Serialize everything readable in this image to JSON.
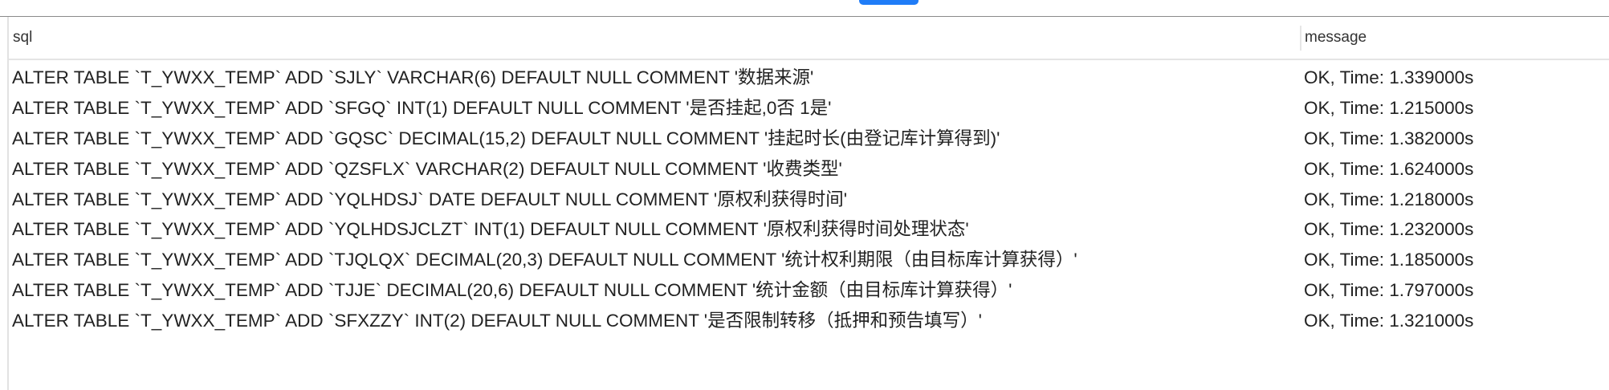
{
  "table": {
    "columns": [
      "sql",
      "message"
    ],
    "rows": [
      {
        "sql": "ALTER TABLE `T_YWXX_TEMP` ADD `SJLY` VARCHAR(6) DEFAULT NULL COMMENT '数据来源'",
        "message": "OK, Time: 1.339000s"
      },
      {
        "sql": "ALTER TABLE `T_YWXX_TEMP` ADD `SFGQ` INT(1) DEFAULT NULL COMMENT '是否挂起,0否 1是'",
        "message": "OK, Time: 1.215000s"
      },
      {
        "sql": "ALTER TABLE `T_YWXX_TEMP` ADD `GQSC` DECIMAL(15,2) DEFAULT NULL COMMENT '挂起时长(由登记库计算得到)'",
        "message": "OK, Time: 1.382000s"
      },
      {
        "sql": "ALTER TABLE `T_YWXX_TEMP` ADD `QZSFLX` VARCHAR(2) DEFAULT NULL COMMENT '收费类型'",
        "message": "OK, Time: 1.624000s"
      },
      {
        "sql": "ALTER TABLE `T_YWXX_TEMP` ADD `YQLHDSJ` DATE DEFAULT NULL COMMENT '原权利获得时间'",
        "message": "OK, Time: 1.218000s"
      },
      {
        "sql": "ALTER TABLE `T_YWXX_TEMP` ADD `YQLHDSJCLZT` INT(1) DEFAULT NULL COMMENT '原权利获得时间处理状态'",
        "message": "OK, Time: 1.232000s"
      },
      {
        "sql": "ALTER TABLE `T_YWXX_TEMP` ADD `TJQLQX` DECIMAL(20,3) DEFAULT NULL COMMENT '统计权利期限（由目标库计算获得）'",
        "message": "OK, Time: 1.185000s"
      },
      {
        "sql": "ALTER TABLE `T_YWXX_TEMP` ADD `TJJE` DECIMAL(20,6) DEFAULT NULL COMMENT '统计金额（由目标库计算获得）'",
        "message": "OK, Time: 1.797000s"
      },
      {
        "sql": "ALTER TABLE `T_YWXX_TEMP` ADD `SFXZZY` INT(2) DEFAULT NULL COMMENT '是否限制转移（抵押和预告填写）'",
        "message": "OK, Time: 1.321000s"
      }
    ]
  },
  "colors": {
    "accent": "#1f7cf7"
  }
}
